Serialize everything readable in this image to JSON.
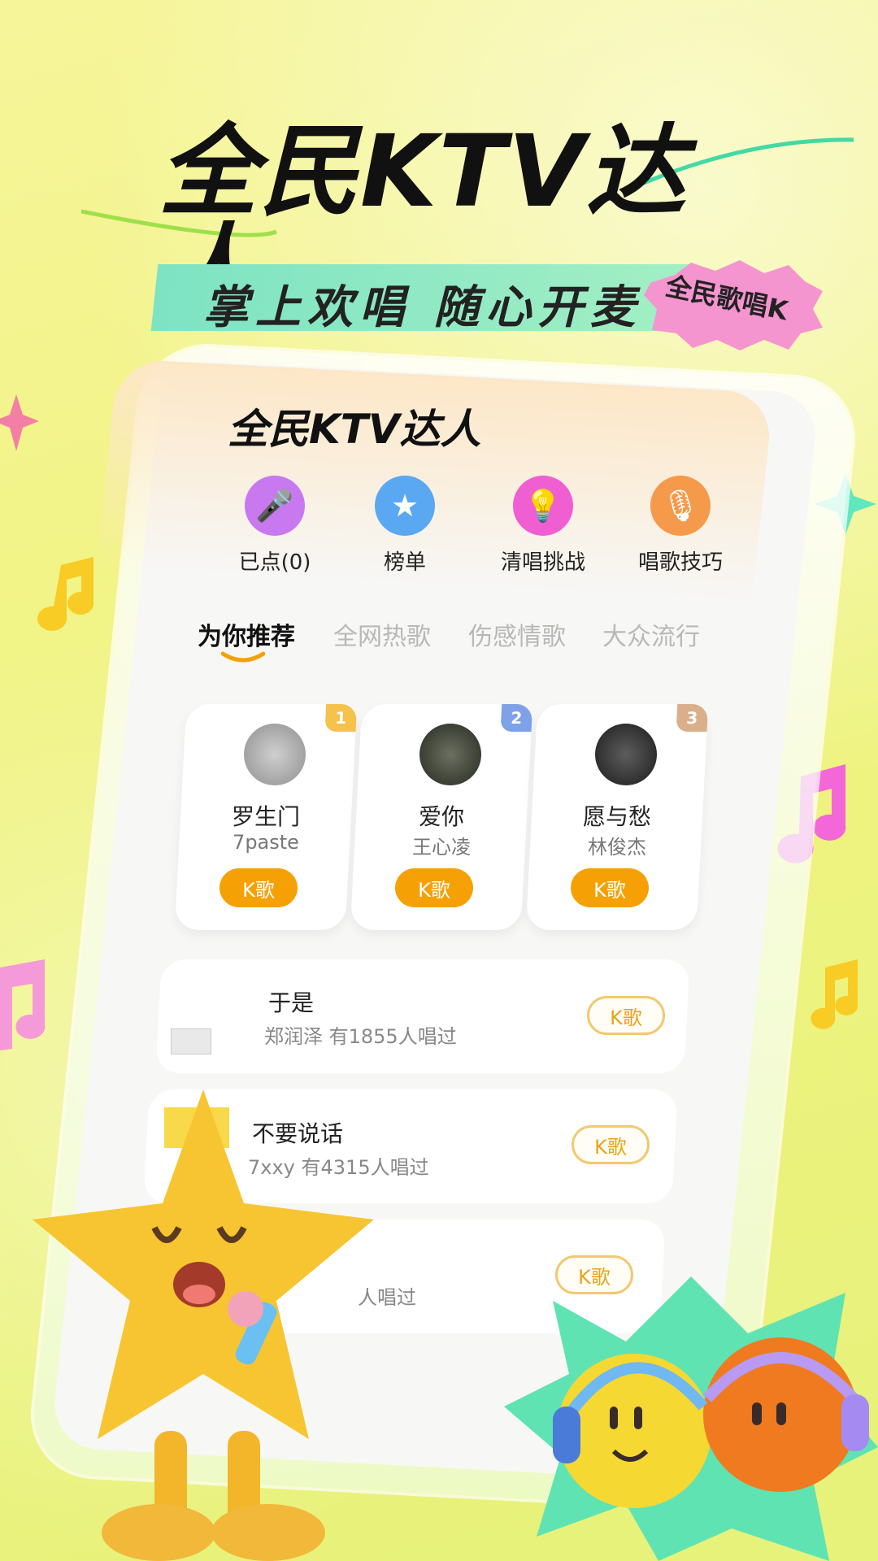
{
  "banner": {
    "headline": "全民KTV达人",
    "subtitle": "掌上欢唱 随心开麦",
    "badge": "全民歌唱K"
  },
  "app": {
    "title": "全民KTV达人",
    "quick_actions": [
      {
        "label": "已点(0)",
        "icon": "microphone-icon",
        "color": "#c879f0"
      },
      {
        "label": "榜单",
        "icon": "medal-star-icon",
        "color": "#5aa8f2"
      },
      {
        "label": "清唱挑战",
        "icon": "lightbulb-icon",
        "color": "#ef5fd1"
      },
      {
        "label": "唱歌技巧",
        "icon": "handheld-mic-icon",
        "color": "#f59a4a"
      }
    ],
    "tabs": [
      "为你推荐",
      "全网热歌",
      "伤感情歌",
      "大众流行"
    ],
    "active_tab": "为你推荐",
    "top_songs": [
      {
        "rank": "1",
        "name": "罗生门",
        "artist": "7paste",
        "button": "K歌",
        "rank_color": "#f6c24c"
      },
      {
        "rank": "2",
        "name": "爱你",
        "artist": "王心凌",
        "button": "K歌",
        "rank_color": "#7fa1e8"
      },
      {
        "rank": "3",
        "name": "愿与愁",
        "artist": "林俊杰",
        "button": "K歌",
        "rank_color": "#d9b08b"
      }
    ],
    "list_songs": [
      {
        "title": "于是",
        "subtitle": "郑润泽  有1855人唱过",
        "button": "K歌"
      },
      {
        "title": "不要说话",
        "subtitle": "7xxy  有4315人唱过",
        "button": "K歌"
      },
      {
        "title": "",
        "subtitle": "人唱过",
        "button": "K歌"
      }
    ]
  },
  "colors": {
    "accent": "#f5a106",
    "background": "#f2f489",
    "mint": "#7de3c3"
  }
}
